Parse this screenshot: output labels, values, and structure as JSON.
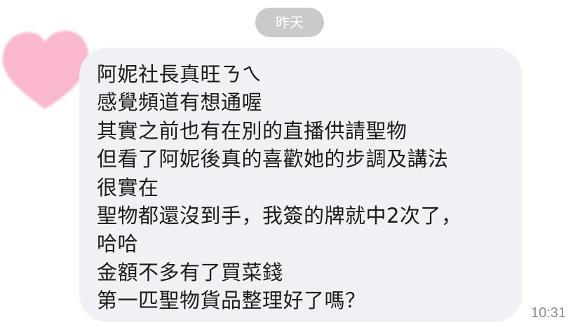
{
  "chat": {
    "date_separator": "昨天",
    "sender_avatar": {
      "icon": "pink-heart-icon",
      "color": "#f9b8cc"
    },
    "message": {
      "lines": [
        "阿妮社長真旺ㄋㄟ",
        "感覺頻道有想通喔",
        "其實之前也有在別的直播供請聖物",
        "但看了阿妮後真的喜歡她的步調及講法",
        "很實在",
        "聖物都還沒到手，我簽的牌就中2次了，",
        "哈哈",
        "金額不多有了買菜錢",
        "第一匹聖物貨品整理好了嗎？"
      ],
      "time": "10:31"
    }
  },
  "colors": {
    "bubble_background": "#f0f1f4",
    "date_pill_background": "#c9cacb",
    "text": "#1b1b1b",
    "timestamp": "#8c8c8c"
  }
}
